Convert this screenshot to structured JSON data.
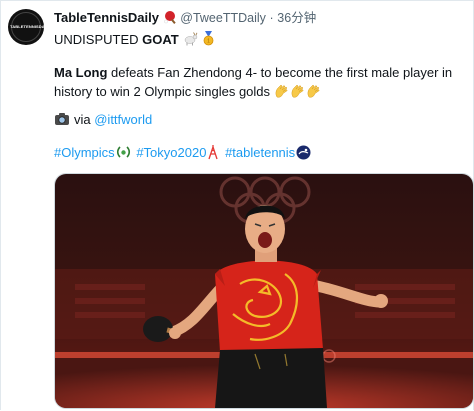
{
  "tweet": {
    "display_name": "TableTennisDaily",
    "handle": "@TweeTTDaily",
    "separator": "·",
    "time": "36分钟",
    "avatar_text": "TABLETENNISDAILY",
    "headline_prefix": "UNDISPUTED ",
    "headline_bold": "GOAT",
    "body_bold": "Ma Long",
    "body_text": " defeats Fan Zhendong 4- to become the first male player in history to win 2 Olympic singles golds",
    "via_text": "via ",
    "via_link": "@ittfworld",
    "hashtags": [
      "#Olympics",
      "#Tokyo2020",
      "#tabletennis"
    ]
  },
  "icons": [
    "table-tennis-paddle-icon",
    "goat-icon",
    "medal-icon",
    "clap-icon",
    "camera-icon",
    "laurel-icon",
    "tokyo-tower-icon",
    "tabletennis-hashflag-icon"
  ],
  "colors": {
    "link": "#1d9bf0",
    "text": "#0f1419",
    "muted": "#536471",
    "shirt": "#d6241a",
    "dragon": "#f6c42a"
  }
}
